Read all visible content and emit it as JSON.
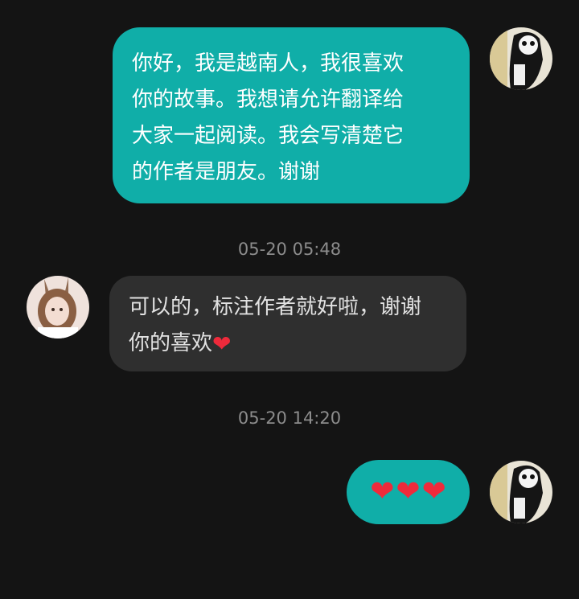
{
  "messages": [
    {
      "sender": "me",
      "lines": [
        "你好，我是越南人，我很喜欢",
        "你的故事。我想请允许翻译给",
        "大家一起阅读。我会写清楚它",
        "的作者是朋友。谢谢"
      ]
    },
    {
      "timestamp": "05-20 05:48",
      "sender": "them",
      "lines": [
        "可以的，标注作者就好啦，谢谢",
        "你的喜欢"
      ],
      "emoji": "❤"
    },
    {
      "timestamp": "05-20 14:20",
      "sender": "me",
      "emoji": [
        "❤",
        "❤",
        "❤"
      ]
    }
  ],
  "colors": {
    "background": "#141414",
    "my_bubble": "#10aea8",
    "their_bubble": "#2f2f2f",
    "heart": "#ef2a3b",
    "timestamp": "#8c8c8c"
  }
}
